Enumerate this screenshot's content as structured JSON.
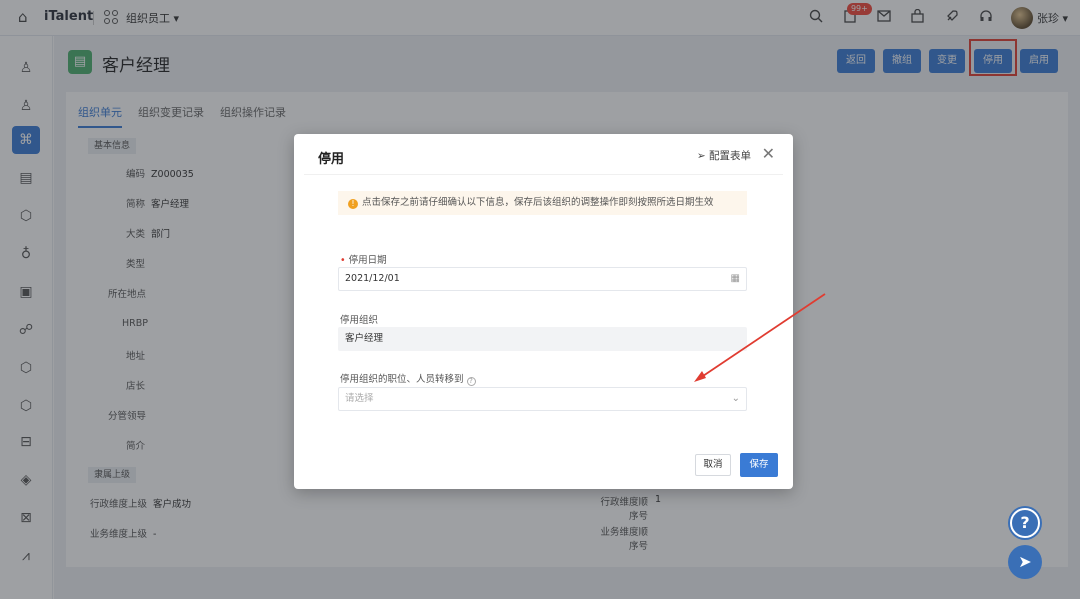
{
  "topbar": {
    "logo": "iTalent",
    "module": "组织员工 ▾",
    "badge": "99+",
    "user": "张珍 ▾"
  },
  "page": {
    "title": "客户经理",
    "buttons": [
      "返回",
      "撤组",
      "变更",
      "停用",
      "启用"
    ]
  },
  "tabs": [
    "组织单元",
    "组织变更记录",
    "组织操作记录"
  ],
  "sections": {
    "basic": "基本信息",
    "parent": "隶属上级"
  },
  "fields": {
    "code_label": "编码",
    "code_value": "Z000035",
    "name_label": "简称",
    "name_value": "客户经理",
    "category_label": "大类",
    "category_value": "部门",
    "type_label": "类型",
    "location_label": "所在地点",
    "hrbp_label": "HRBP",
    "address_label": "地址",
    "head_label": "店长",
    "leader_label": "分管领导",
    "intro_label": "简介",
    "admin_parent_label": "行政维度上级",
    "admin_parent_value": "客户成功",
    "biz_parent_label": "业务维度上级",
    "biz_parent_value": "-",
    "admin_order_label": "行政维度顺序号",
    "admin_order_value": "1",
    "biz_order_label": "业务维度顺序号"
  },
  "modal": {
    "title": "停用",
    "config": "配置表单",
    "notice": "点击保存之前请仔细确认以下信息，保存后该组织的调整操作即刻按照所选日期生效",
    "date_label": "停用日期",
    "date_value": "2021/12/01",
    "org_label": "停用组织",
    "org_value": "客户经理",
    "transfer_label": "停用组织的职位、人员转移到",
    "transfer_placeholder": "请选择",
    "cancel": "取消",
    "save": "保存"
  },
  "colors": {
    "primary": "#3a7bd5",
    "highlight": "#e03c31",
    "active_tab": "#3a7bd5",
    "warning": "#f0a020"
  }
}
